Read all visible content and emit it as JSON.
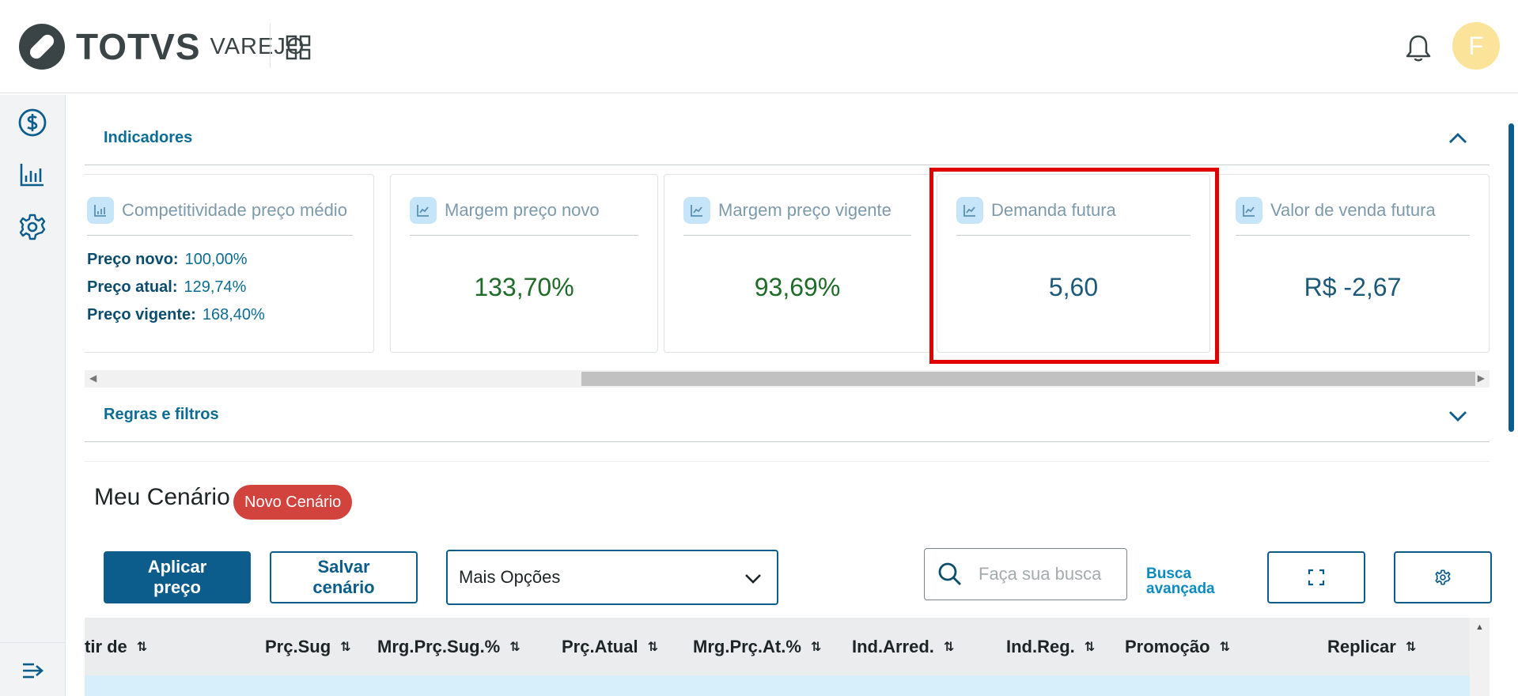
{
  "header": {
    "brand": "TOTVS",
    "brand_sub": "VAREJO",
    "avatar_initial": "F"
  },
  "sidebar": {
    "icons": [
      "dollar-icon",
      "bar-chart-icon",
      "gear-icon",
      "collapse-menu-icon"
    ]
  },
  "indicators": {
    "title": "Indicadores",
    "cards": [
      {
        "title": "Competitividade preço médio",
        "icon": "bar-chart-icon",
        "rows": [
          {
            "label": "Preço novo:",
            "value": "100,00%"
          },
          {
            "label": "Preço atual:",
            "value": "129,74%"
          },
          {
            "label": "Preço vigente:",
            "value": "168,40%"
          }
        ]
      },
      {
        "title": "Margem preço novo",
        "icon": "trend-chart-icon",
        "value": "133,70%",
        "color": "#1f6b2a"
      },
      {
        "title": "Margem preço vigente",
        "icon": "trend-chart-icon",
        "value": "93,69%",
        "color": "#1f6b2a"
      },
      {
        "title": "Demanda futura",
        "icon": "trend-chart-icon",
        "value": "5,60",
        "color": "#1d5a7a"
      },
      {
        "title": "Valor de venda futura",
        "icon": "trend-chart-icon",
        "value": "R$ -2,67",
        "color": "#1d5a7a"
      }
    ],
    "highlight_color": "#e00000"
  },
  "rules": {
    "title": "Regras e filtros"
  },
  "scenario": {
    "heading": "Meu Cenário",
    "badge": "Novo Cenário",
    "apply_label_1": "Aplicar",
    "apply_label_2": "preço",
    "save_label_1": "Salvar",
    "save_label_2": "cenário",
    "options_select": "Mais Opções",
    "search_placeholder": "Faça sua busca",
    "advanced_1": "Busca",
    "advanced_2": "avançada"
  },
  "table": {
    "columns": [
      "tir de",
      "Prç.Sug",
      "Mrg.Prç.Sug.%",
      "Prç.Atual",
      "Mrg.Prç.At.%",
      "Ind.Arred.",
      "Ind.Reg.",
      "Promoção",
      "Replicar"
    ]
  },
  "colors": {
    "primary": "#0c5d8c",
    "accent": "#0c6c94",
    "badge": "#d1433c",
    "positive": "#1f6b2a"
  }
}
